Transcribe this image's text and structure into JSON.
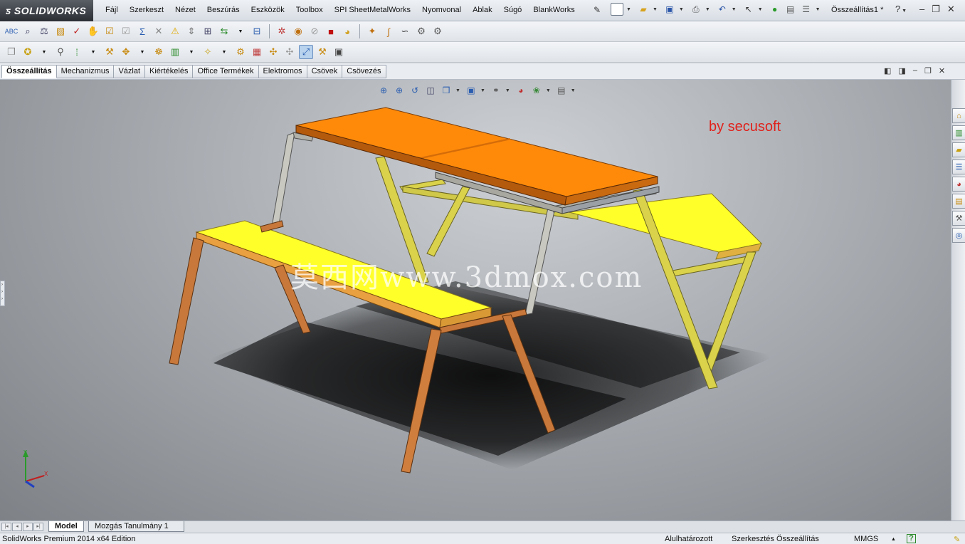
{
  "app": {
    "logo_text": "SOLIDWORKS",
    "document_title": "Összeállítás1 *"
  },
  "menu": {
    "items": [
      "Fájl",
      "Szerkeszt",
      "Nézet",
      "Beszúrás",
      "Eszközök",
      "Toolbox",
      "SPI SheetMetalWorks",
      "Nyomvonal",
      "Ablak",
      "Súgó",
      "BlankWorks"
    ]
  },
  "command_tabs": {
    "items": [
      "Összeállítás",
      "Mechanizmus",
      "Vázlat",
      "Kiértékelés",
      "Office Termékek",
      "Elektromos",
      "Csövek",
      "Csövezés"
    ],
    "active": "Összeállítás"
  },
  "viewport": {
    "credit_text": "by secusoft",
    "watermark_text": "莫西网www.3dmox.com",
    "triad": {
      "y_label": "Y",
      "x_label": "X"
    }
  },
  "model_tabs": {
    "items": [
      "Model",
      "Mozgás Tanulmány 1"
    ],
    "active": "Model"
  },
  "status": {
    "edition": "SolidWorks Premium 2014 x64 Edition",
    "definition_state": "Alulhatározott",
    "edit_mode": "Szerkesztés Összeállítás",
    "units": "MMGS",
    "help_glyph": "?"
  },
  "colors": {
    "table_top": "#ff8a0a",
    "table_edge": "#b45a0c",
    "bench_top": "#ffff2a",
    "bench_edge": "#c98a2e",
    "leg_wood": "#c8783a",
    "frame_steel": "#b8b8a8",
    "frame_yellow": "#d9d24a",
    "credit_red": "#e0211b"
  }
}
